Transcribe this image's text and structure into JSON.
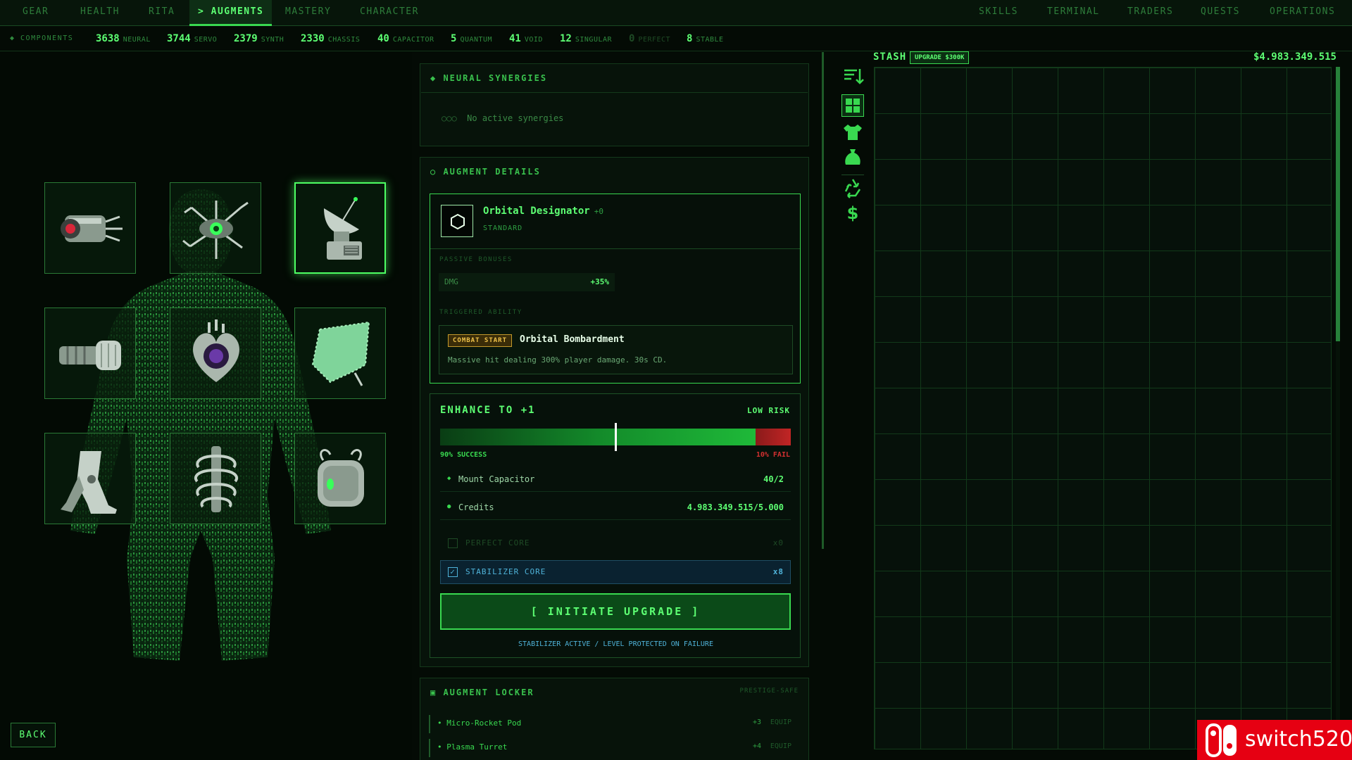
{
  "nav": {
    "left_tabs": [
      {
        "label": "GEAR"
      },
      {
        "label": "HEALTH"
      },
      {
        "label": "RITA"
      },
      {
        "label": "> AUGMENTS"
      },
      {
        "label": "MASTERY"
      },
      {
        "label": "CHARACTER"
      }
    ],
    "right_tabs": [
      {
        "label": "SKILLS"
      },
      {
        "label": "TERMINAL"
      },
      {
        "label": "TRADERS"
      },
      {
        "label": "QUESTS"
      },
      {
        "label": "OPERATIONS"
      }
    ],
    "active_tab": "> AUGMENTS"
  },
  "components": {
    "label": "◆ COMPONENTS",
    "items": [
      {
        "value": "3638",
        "name": "NEURAL"
      },
      {
        "value": "3744",
        "name": "SERVO"
      },
      {
        "value": "2379",
        "name": "SYNTH"
      },
      {
        "value": "2330",
        "name": "CHASSIS"
      },
      {
        "value": "40",
        "name": "CAPACITOR"
      },
      {
        "value": "5",
        "name": "QUANTUM"
      },
      {
        "value": "41",
        "name": "VOID"
      },
      {
        "value": "12",
        "name": "SINGULAR"
      },
      {
        "value": "0",
        "name": "PERFECT"
      },
      {
        "value": "8",
        "name": "STABLE"
      }
    ]
  },
  "slots": [
    {
      "item": "cannon-augment"
    },
    {
      "item": "neural-augment"
    },
    {
      "item": "orbital-designator"
    },
    {
      "item": "servo-fist-augment"
    },
    {
      "item": "core-heart-augment"
    },
    {
      "item": "mesh-cloak-augment"
    },
    {
      "item": "leg-servo-augment"
    },
    {
      "item": "spine-augment"
    },
    {
      "item": "reactor-pack-augment"
    }
  ],
  "back_label": "BACK",
  "synergies": {
    "title": "NEURAL SYNERGIES",
    "empty_text": "No active synergies",
    "empty_dots": "○○○"
  },
  "details": {
    "title": "AUGMENT DETAILS",
    "name": "Orbital Designator",
    "level": "+0",
    "tier": "STANDARD",
    "passive_label": "PASSIVE BONUSES",
    "passive": {
      "stat": "DMG",
      "value": "+35%"
    },
    "triggered_label": "TRIGGERED ABILITY",
    "ability": {
      "trigger": "COMBAT START",
      "name": "Orbital Bombardment",
      "desc": "Massive hit dealing 300% player damage. 30s CD."
    }
  },
  "enhance": {
    "title": "ENHANCE TO +1",
    "risk": "LOW RISK",
    "success_pct": 90,
    "success_text": "90% SUCCESS",
    "fail_text": "10% FAIL",
    "requirements": [
      {
        "bullet": "◆",
        "name": "Mount Capacitor",
        "value": "40/2"
      },
      {
        "bullet": "●",
        "name": "Credits",
        "value": "4.983.349.515/5.000"
      }
    ],
    "perfect_core": {
      "label": "PERFECT CORE",
      "count": "x0"
    },
    "stabilizer_core": {
      "label": "STABILIZER CORE",
      "count": "x8",
      "check": "✓"
    },
    "button": "[ INITIATE UPGRADE ]",
    "note": "STABILIZER ACTIVE / LEVEL PROTECTED ON FAILURE"
  },
  "locker": {
    "title": "AUGMENT LOCKER",
    "tag": "PRESTIGE-SAFE",
    "items": [
      {
        "name": "Micro-Rocket Pod",
        "level": "+3",
        "action": "EQUIP"
      },
      {
        "name": "Plasma Turret",
        "level": "+4",
        "action": "EQUIP"
      }
    ]
  },
  "stash": {
    "title": "STASH",
    "upgrade": "UPGRADE $300K",
    "balance": "$4.983.349.515"
  },
  "tools": [
    {
      "icon": "sort-icon"
    },
    {
      "icon": "grid-icon"
    },
    {
      "icon": "armor-icon"
    },
    {
      "icon": "loot-bag-icon"
    },
    {
      "icon": "recycle-icon"
    },
    {
      "icon": "dollar-icon"
    }
  ],
  "watermark": {
    "text": "switch520"
  },
  "colors": {
    "accent": "#5dff73",
    "bg": "#040b05",
    "fail": "#c12525",
    "trigger": "#f0c34a",
    "stabilizer": "#4fb3d9"
  }
}
